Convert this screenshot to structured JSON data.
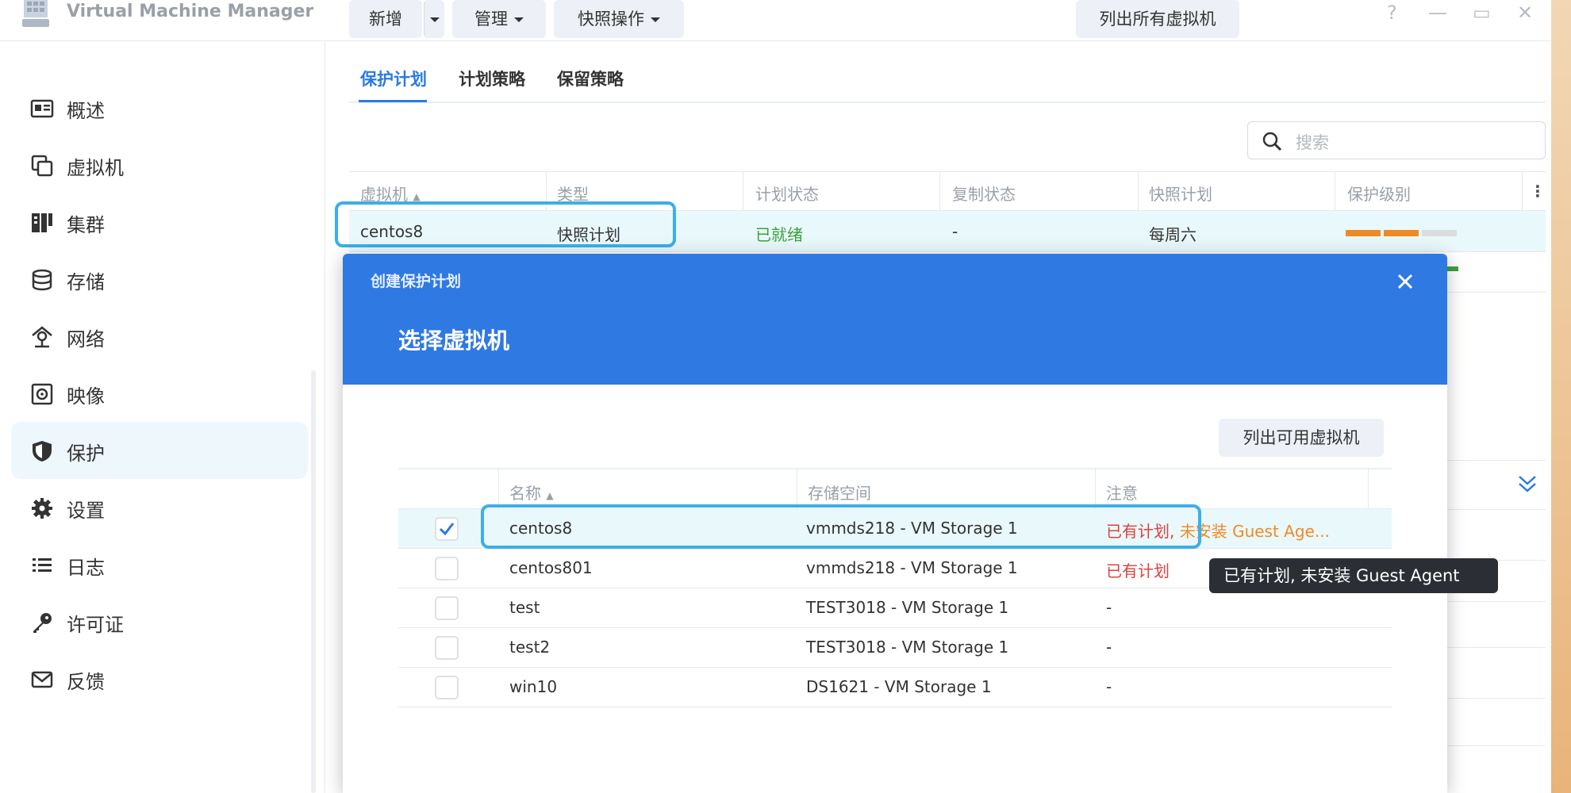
{
  "window": {
    "title": "Virtual Machine Manager",
    "controls": [
      "?",
      "—",
      "▭",
      "✕"
    ]
  },
  "sidebar": {
    "items": [
      {
        "label": "概述",
        "icon": "overview-icon"
      },
      {
        "label": "虚拟机",
        "icon": "virtual-machine-icon"
      },
      {
        "label": "集群",
        "icon": "cluster-icon"
      },
      {
        "label": "存储",
        "icon": "storage-icon"
      },
      {
        "label": "网络",
        "icon": "network-icon"
      },
      {
        "label": "映像",
        "icon": "image-icon"
      },
      {
        "label": "保护",
        "icon": "shield-icon",
        "active": true
      },
      {
        "label": "设置",
        "icon": "gear-icon"
      },
      {
        "label": "日志",
        "icon": "log-list-icon"
      },
      {
        "label": "许可证",
        "icon": "key-icon"
      },
      {
        "label": "反馈",
        "icon": "mail-icon"
      }
    ]
  },
  "tabs": [
    {
      "label": "保护计划",
      "active": true
    },
    {
      "label": "计划策略"
    },
    {
      "label": "保留策略"
    }
  ],
  "toolbar": {
    "add": "新增",
    "manage": "管理",
    "snapshot_ops": "快照操作",
    "list_all_vms": "列出所有虚拟机",
    "search_placeholder": "搜索"
  },
  "grid": {
    "columns": [
      "虚拟机",
      "类型",
      "计划状态",
      "复制状态",
      "快照计划",
      "保护级别"
    ],
    "rows": [
      {
        "vm": "centos8",
        "type": "快照计划",
        "plan_status": "已就绪",
        "replication_status": "-",
        "snapshot_plan": "每周六",
        "level_filled": 2,
        "level_total": 3
      }
    ]
  },
  "modal": {
    "subtitle": "创建保护计划",
    "title": "选择虚拟机",
    "list_button": "列出可用虚拟机",
    "columns": [
      "名称",
      "存储空间",
      "注意"
    ],
    "rows": [
      {
        "name": "centos8",
        "storage": "vmmds218 - VM Storage 1",
        "note_red": "已有计划,",
        "note_orange": " 未安装 Guest Age...",
        "checked": true
      },
      {
        "name": "centos801",
        "storage": "vmmds218 - VM Storage 1",
        "note_red": "已有计划",
        "note_orange": "",
        "checked": false
      },
      {
        "name": "test",
        "storage": "TEST3018 - VM Storage 1",
        "note_red": "",
        "note_plain": "-",
        "checked": false
      },
      {
        "name": "test2",
        "storage": "TEST3018 - VM Storage 1",
        "note_red": "",
        "note_plain": "-",
        "checked": false
      },
      {
        "name": "win10",
        "storage": "DS1621 - VM Storage 1",
        "note_red": "",
        "note_plain": "-",
        "checked": false
      }
    ],
    "tooltip": "已有计划, 未安装 Guest Agent"
  },
  "colors": {
    "accent": "#2a7ae2",
    "header": "#2f79e2",
    "ready": "#3aa13a",
    "warn_red": "#e0413b",
    "warn_orange": "#f08a24",
    "level_filled": "#f08a24",
    "level_empty": "#dcdcdc"
  }
}
